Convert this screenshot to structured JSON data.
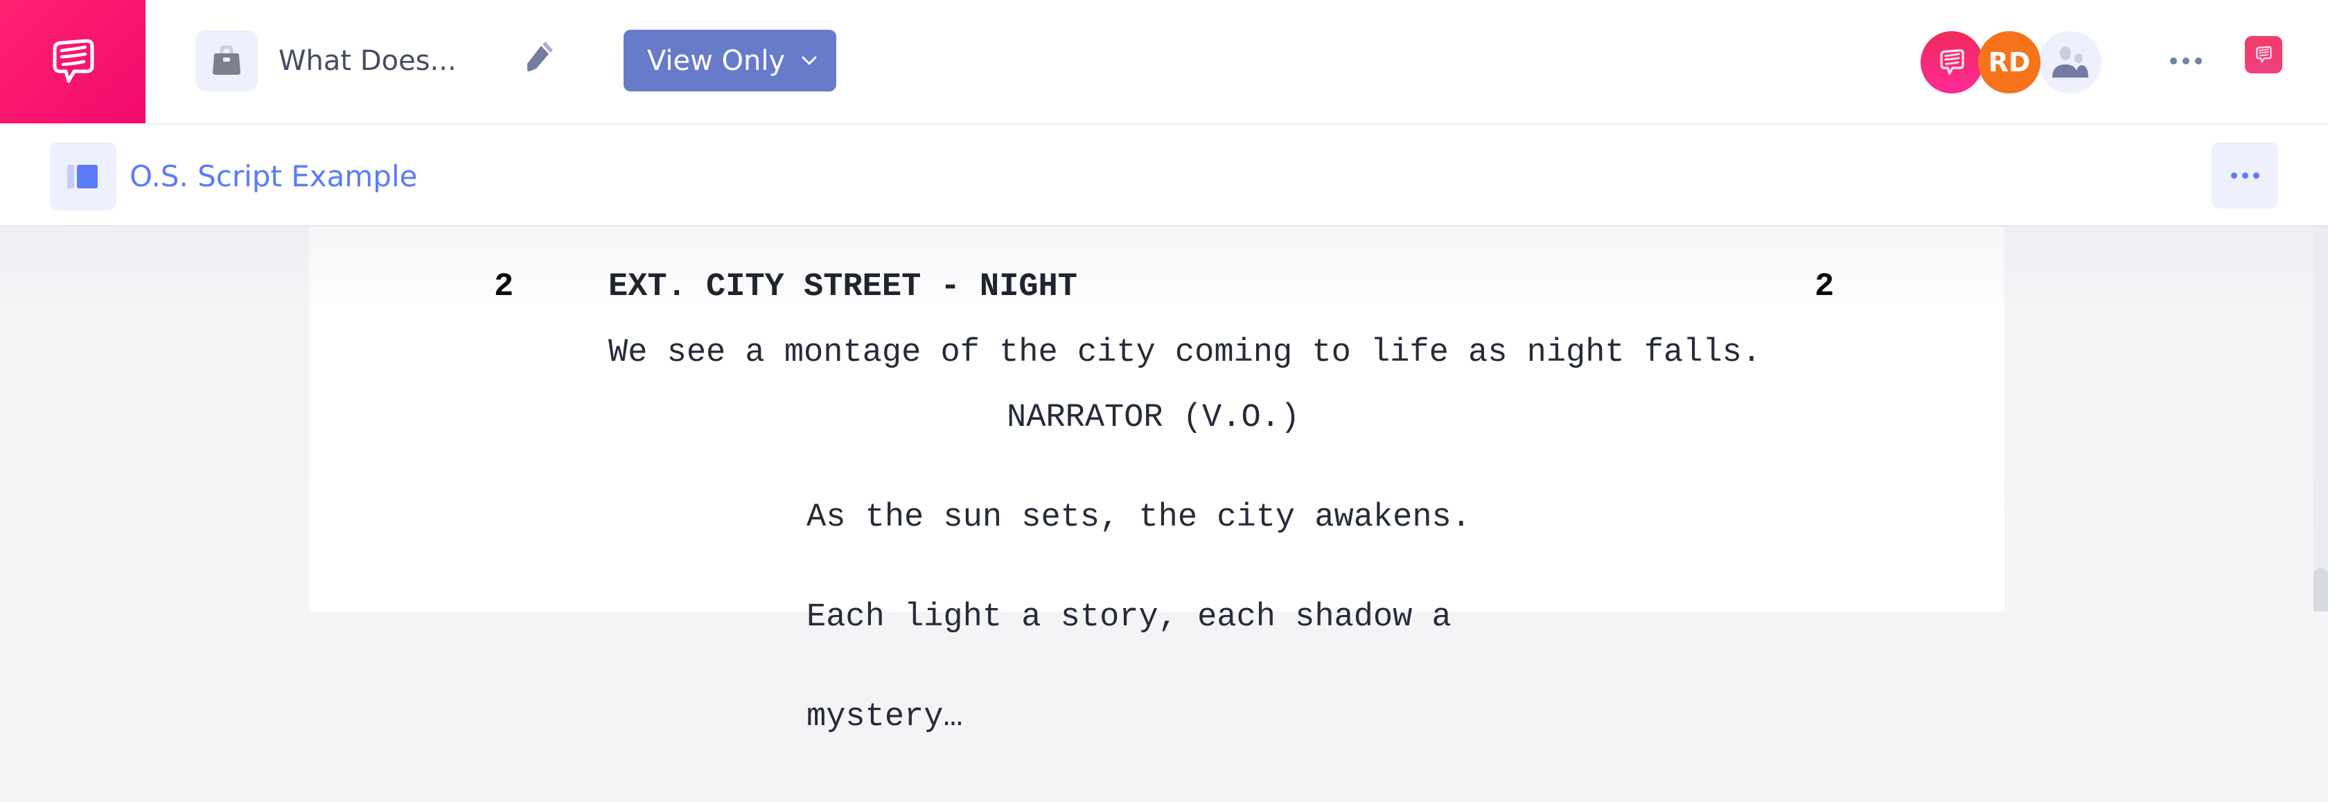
{
  "header": {
    "project_title": "What Does...",
    "view_mode_label": "View Only",
    "collaborators": [
      {
        "type": "brand",
        "label": ""
      },
      {
        "type": "initials",
        "label": "RD"
      },
      {
        "type": "group",
        "label": ""
      }
    ],
    "colors": {
      "brand_pink": "#f5106e",
      "view_button": "#677bcb",
      "avatar_orange": "#f6731c"
    }
  },
  "subheader": {
    "document_title": "O.S. Script Example",
    "accent": "#5b7bfb"
  },
  "script": {
    "scene_number": "2",
    "scene_heading": "EXT. CITY STREET - NIGHT",
    "action": "We see a montage of the city coming to life as night falls.",
    "character": "NARRATOR (V.O.)",
    "dialogue_lines": [
      "As the sun sets, the city awakens.",
      "Each light a story, each shadow a",
      "mystery…"
    ]
  }
}
